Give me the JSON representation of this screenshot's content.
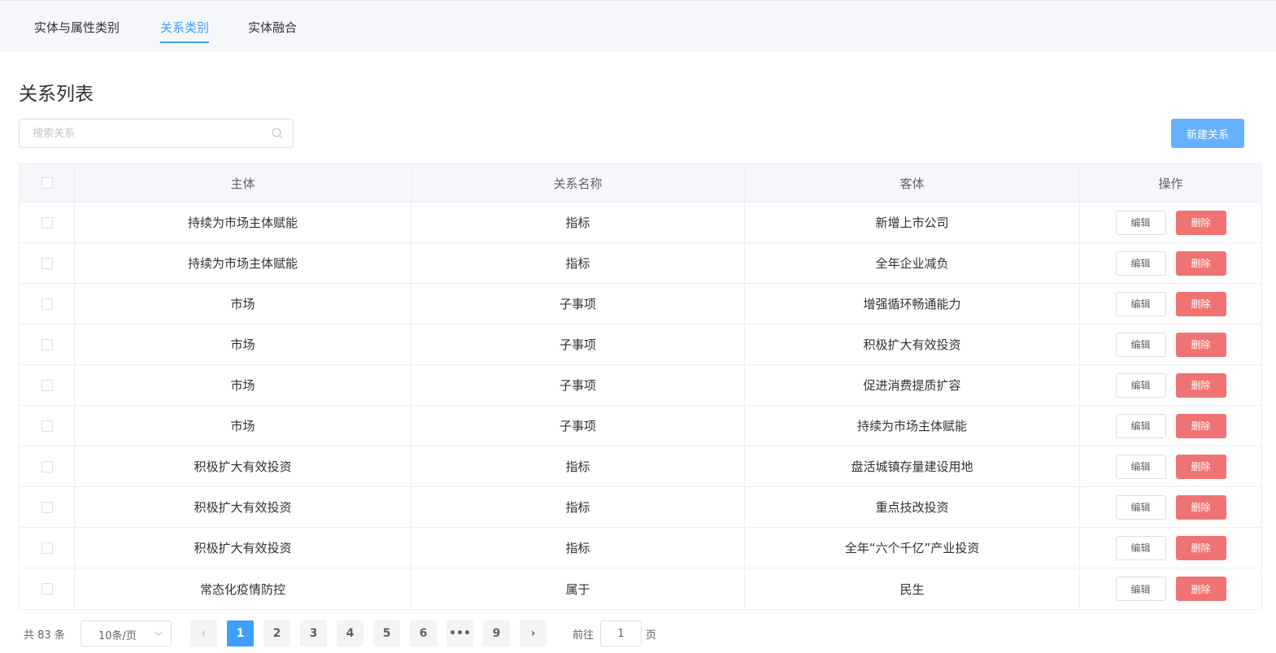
{
  "tabs": [
    {
      "label": "实体与属性类别",
      "active": false
    },
    {
      "label": "关系类别",
      "active": true
    },
    {
      "label": "实体融合",
      "active": false
    }
  ],
  "page_title": "关系列表",
  "search": {
    "placeholder": "搜索关系",
    "value": ""
  },
  "new_button": "新建关系",
  "table": {
    "headers": [
      "主体",
      "关系名称",
      "客体",
      "操作"
    ],
    "rows": [
      {
        "subject": "持续为市场主体赋能",
        "relation": "指标",
        "object": "新增上市公司"
      },
      {
        "subject": "持续为市场主体赋能",
        "relation": "指标",
        "object": "全年企业减负"
      },
      {
        "subject": "市场",
        "relation": "子事项",
        "object": "增强循环畅通能力"
      },
      {
        "subject": "市场",
        "relation": "子事项",
        "object": "积极扩大有效投资"
      },
      {
        "subject": "市场",
        "relation": "子事项",
        "object": "促进消费提质扩容"
      },
      {
        "subject": "市场",
        "relation": "子事项",
        "object": "持续为市场主体赋能"
      },
      {
        "subject": "积极扩大有效投资",
        "relation": "指标",
        "object": "盘活城镇存量建设用地"
      },
      {
        "subject": "积极扩大有效投资",
        "relation": "指标",
        "object": "重点技改投资"
      },
      {
        "subject": "积极扩大有效投资",
        "relation": "指标",
        "object": "全年“六个千亿”产业投资"
      },
      {
        "subject": "常态化疫情防控",
        "relation": "属于",
        "object": "民生"
      }
    ],
    "edit_label": "编辑",
    "delete_label": "删除"
  },
  "pagination": {
    "total_text": "共 83 条",
    "page_size": "10条/页",
    "pages": [
      "1",
      "2",
      "3",
      "4",
      "5",
      "6",
      "•••",
      "9"
    ],
    "current_page": "1",
    "prev_label": "‹",
    "next_label": "›",
    "goto_label": "前往",
    "goto_value": "1",
    "goto_suffix": "页"
  }
}
